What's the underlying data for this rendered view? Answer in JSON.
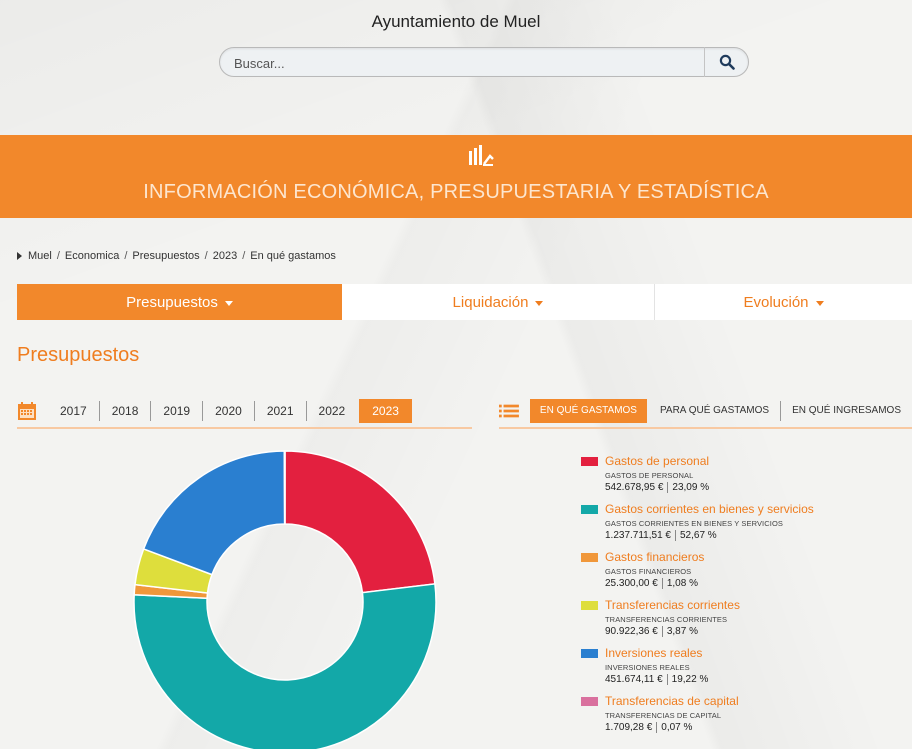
{
  "header": {
    "site_title": "Ayuntamiento de Muel",
    "search_placeholder": "Buscar...",
    "search_icon": "search-icon"
  },
  "banner": {
    "icon": "bar-chart-icon",
    "title": "INFORMACIÓN ECONÓMICA, PRESUPUESTARIA Y ESTADÍSTICA",
    "color": "#f2882b"
  },
  "breadcrumb": [
    "Muel",
    "Economica",
    "Presupuestos",
    "2023",
    "En qué gastamos"
  ],
  "tabs": [
    {
      "label": "Presupuestos",
      "active": true
    },
    {
      "label": "Liquidación",
      "active": false
    },
    {
      "label": "Evolución",
      "active": false
    }
  ],
  "section_title": "Presupuestos",
  "years": {
    "icon": "calendar-icon",
    "items": [
      "2017",
      "2018",
      "2019",
      "2020",
      "2021",
      "2022",
      "2023"
    ],
    "selected": "2023"
  },
  "views": {
    "icon": "list-icon",
    "items": [
      "EN QUÉ GASTAMOS",
      "PARA QUÉ GASTAMOS",
      "EN QUÉ INGRESAMOS"
    ],
    "selected": "EN QUÉ GASTAMOS"
  },
  "chart_data": {
    "type": "pie",
    "categories": [
      "Gastos de personal",
      "Gastos corrientes en bienes y servicios",
      "Gastos financieros",
      "Transferencias corrientes",
      "Inversiones reales",
      "Transferencias de capital"
    ],
    "values": [
      23.09,
      52.67,
      1.08,
      3.87,
      19.22,
      0.07
    ],
    "colors": [
      "#e3203f",
      "#13a8a8",
      "#f0973a",
      "#dede3c",
      "#2a7fd0",
      "#d9709e"
    ]
  },
  "legend": [
    {
      "title": "Gastos de personal",
      "sub": "GASTOS DE PERSONAL",
      "amount": "542.678,95 €",
      "pct": "23,09 %"
    },
    {
      "title": "Gastos corrientes en bienes y servicios",
      "sub": "GASTOS CORRIENTES EN BIENES Y SERVICIOS",
      "amount": "1.237.711,51 €",
      "pct": "52,67 %"
    },
    {
      "title": "Gastos financieros",
      "sub": "GASTOS FINANCIEROS",
      "amount": "25.300,00 €",
      "pct": "1,08 %"
    },
    {
      "title": "Transferencias corrientes",
      "sub": "TRANSFERENCIAS CORRIENTES",
      "amount": "90.922,36 €",
      "pct": "3,87 %"
    },
    {
      "title": "Inversiones reales",
      "sub": "INVERSIONES REALES",
      "amount": "451.674,11 €",
      "pct": "19,22 %"
    },
    {
      "title": "Transferencias de capital",
      "sub": "TRANSFERENCIAS DE CAPITAL",
      "amount": "1.709,28 €",
      "pct": "0,07 %"
    }
  ]
}
